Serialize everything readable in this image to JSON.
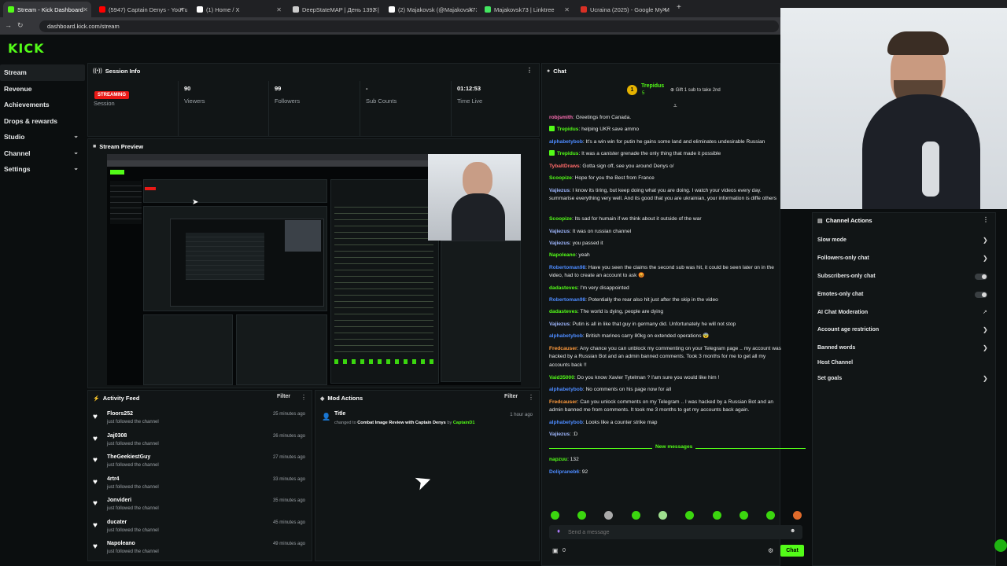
{
  "browser": {
    "tabs": [
      {
        "title": "Stream - Kick Dashboard",
        "color": "#53fc18"
      },
      {
        "title": "(5947) Captain Denys - YouTub",
        "color": "#ff0000"
      },
      {
        "title": "(1) Home / X",
        "color": "#ffffff"
      },
      {
        "title": "DeepStateMAP | День 1392 | М",
        "color": "#cccccc"
      },
      {
        "title": "(2) Majakovsk (@Majakovsk73) /",
        "color": "#ffffff"
      },
      {
        "title": "Majakovsk73 | Linktree",
        "color": "#43e660"
      },
      {
        "title": "Ucraina (2025) - Google My M",
        "color": "#d93025"
      }
    ],
    "url": "dashboard.kick.com/stream"
  },
  "app": {
    "logo": "KICK"
  },
  "sidebar": {
    "items": [
      {
        "label": "Stream",
        "active": true
      },
      {
        "label": "Revenue"
      },
      {
        "label": "Achievements"
      },
      {
        "label": "Drops & rewards"
      },
      {
        "label": "Studio",
        "expandable": true
      },
      {
        "label": "Channel",
        "expandable": true
      },
      {
        "label": "Settings",
        "expandable": true
      }
    ]
  },
  "session": {
    "title": "Session Info",
    "status": "STREAMING",
    "session_label": "Session",
    "viewers": "90",
    "viewers_label": "Viewers",
    "followers": "99",
    "followers_label": "Followers",
    "subs": "-",
    "subs_label": "Sub Counts",
    "time": "01:12:53",
    "time_label": "Time Live"
  },
  "preview": {
    "title": "Stream Preview"
  },
  "activity": {
    "title": "Activity Feed",
    "filter": "Filter",
    "items": [
      {
        "name": "Floors252",
        "text": "just followed the channel",
        "time": "25 minutes ago"
      },
      {
        "name": "Jaj0308",
        "text": "just followed the channel",
        "time": "26 minutes ago"
      },
      {
        "name": "TheGeekiestGuy",
        "text": "just followed the channel",
        "time": "27 minutes ago"
      },
      {
        "name": "4rtr4",
        "text": "just followed the channel",
        "time": "33 minutes ago"
      },
      {
        "name": "Jonvideri",
        "text": "just followed the channel",
        "time": "35 minutes ago"
      },
      {
        "name": "ducater",
        "text": "just followed the channel",
        "time": "45 minutes ago"
      },
      {
        "name": "Napoleano",
        "text": "just followed the channel",
        "time": "49 minutes ago"
      }
    ]
  },
  "mod": {
    "title": "Mod Actions",
    "filter": "Filter",
    "action_title": "Title",
    "changed_to": "changed to",
    "new_title": "Combat Image Review with Captain Denys",
    "by": "by",
    "moderator": "CaptainD1",
    "time": "1 hour ago"
  },
  "chat": {
    "title": "Chat",
    "pinned_user": "Trepidus",
    "pinned_count": "5",
    "pinned_text": "Gift 1 sub to take 2nd",
    "messages": [
      {
        "user": "robjsmith",
        "color": "#ff6fb5",
        "text": "Greetings from Canada."
      },
      {
        "user": "Trepidus",
        "color": "#53fc18",
        "badge": true,
        "text": "helping UKR save ammo"
      },
      {
        "user": "alphabetybob",
        "color": "#4d8bff",
        "text": "It's a win win for putin he gains some land and eliminates undesirable Russian"
      },
      {
        "user": "Trepidus",
        "color": "#53fc18",
        "badge": true,
        "text": "It was a canister grenade the only thing that made it possible"
      },
      {
        "user": "TybaltDraws",
        "color": "#ff6a6a",
        "text": "Gotta sign off, see you around Denys o/"
      },
      {
        "user": "Scoopize",
        "color": "#53fc18",
        "text": "Hope for you the Best from France"
      },
      {
        "user": "Vajiezus",
        "color": "#9fb7ff",
        "text": "I know its tiring, but keep doing what you are doing. I watch your videos every day. summarise everything very well. And its good that you are ukrainian, your information is diffe others"
      },
      {
        "user": "Scoopize",
        "color": "#53fc18",
        "text": "Its sad for humain if we think about it outside of the war"
      },
      {
        "user": "Vajiezus",
        "color": "#9fb7ff",
        "text": "It was on russian channel"
      },
      {
        "user": "Vajiezus",
        "color": "#9fb7ff",
        "text": "you passed it"
      },
      {
        "user": "Napoleano",
        "color": "#53fc18",
        "text": "yeah"
      },
      {
        "user": "Robertoman98",
        "color": "#4d8bff",
        "text": "Have you seen the claims the second sub was hit, it could be seen later on in the video, had to create an account to ask 😡"
      },
      {
        "user": "dadasteves",
        "color": "#53fc18",
        "text": "I'm very disappointed"
      },
      {
        "user": "Robertoman98",
        "color": "#4d8bff",
        "text": "Potentially the rear also hit just after the skip in the video"
      },
      {
        "user": "dadasteves",
        "color": "#53fc18",
        "text": "The world is dying, people are dying"
      },
      {
        "user": "Vajiezus",
        "color": "#9fb7ff",
        "text": "Putin is all in like that guy in germany did. Unfortunately he will not stop"
      },
      {
        "user": "alphabetybob",
        "color": "#4d8bff",
        "text": "British marines carry 80kg on extended operations 😨"
      },
      {
        "user": "Fredcauser",
        "color": "#ff9a3d",
        "text": "Any chance you can unblock my commenting on your Telegram page .. my account was hacked by a Russian Bot and an admin banned comments. Took 3 months for me to get all my accounts back !!"
      },
      {
        "user": "Vaid35000",
        "color": "#53fc18",
        "text": "Do you know Xavier Tytelman ? I'am sure you would like him !"
      },
      {
        "user": "alphabetybob",
        "color": "#4d8bff",
        "text": "No comments on his page now for all"
      },
      {
        "user": "Fredcauser",
        "color": "#ff9a3d",
        "text": "Can you unlock comments on my Telegram .. I was hacked by a Russian Bot and an admin banned me from comments. It took me 3 months to get my accounts back again."
      },
      {
        "user": "alphabetybob",
        "color": "#4d8bff",
        "text": "Looks like a counter strike map"
      },
      {
        "user": "Vajiezus",
        "color": "#9fb7ff",
        "text": ":D"
      }
    ],
    "new_messages_label": "New messages",
    "new_messages": [
      {
        "user": "napzuu",
        "color": "#53fc18",
        "text": "132"
      },
      {
        "user": "Dolipraneb6",
        "color": "#4d8bff",
        "text": "92"
      }
    ],
    "input_placeholder": "Send a message",
    "points": "0",
    "send_label": "Chat"
  },
  "channel_actions": {
    "title": "Channel Actions",
    "items": [
      {
        "label": "Slow mode",
        "kind": "chevron"
      },
      {
        "label": "Followers-only chat",
        "kind": "chevron"
      },
      {
        "label": "Subscribers-only chat",
        "kind": "toggle"
      },
      {
        "label": "Emotes-only chat",
        "kind": "toggle"
      },
      {
        "label": "AI Chat Moderation",
        "kind": "external"
      },
      {
        "label": "Account age restriction",
        "kind": "chevron"
      },
      {
        "label": "Banned words",
        "kind": "chevron"
      },
      {
        "label": "Host Channel",
        "kind": "none"
      },
      {
        "label": "Set goals",
        "kind": "chevron"
      }
    ]
  },
  "colors": {
    "accent": "#53fc18",
    "live": "#e91916",
    "panel": "#111516"
  }
}
